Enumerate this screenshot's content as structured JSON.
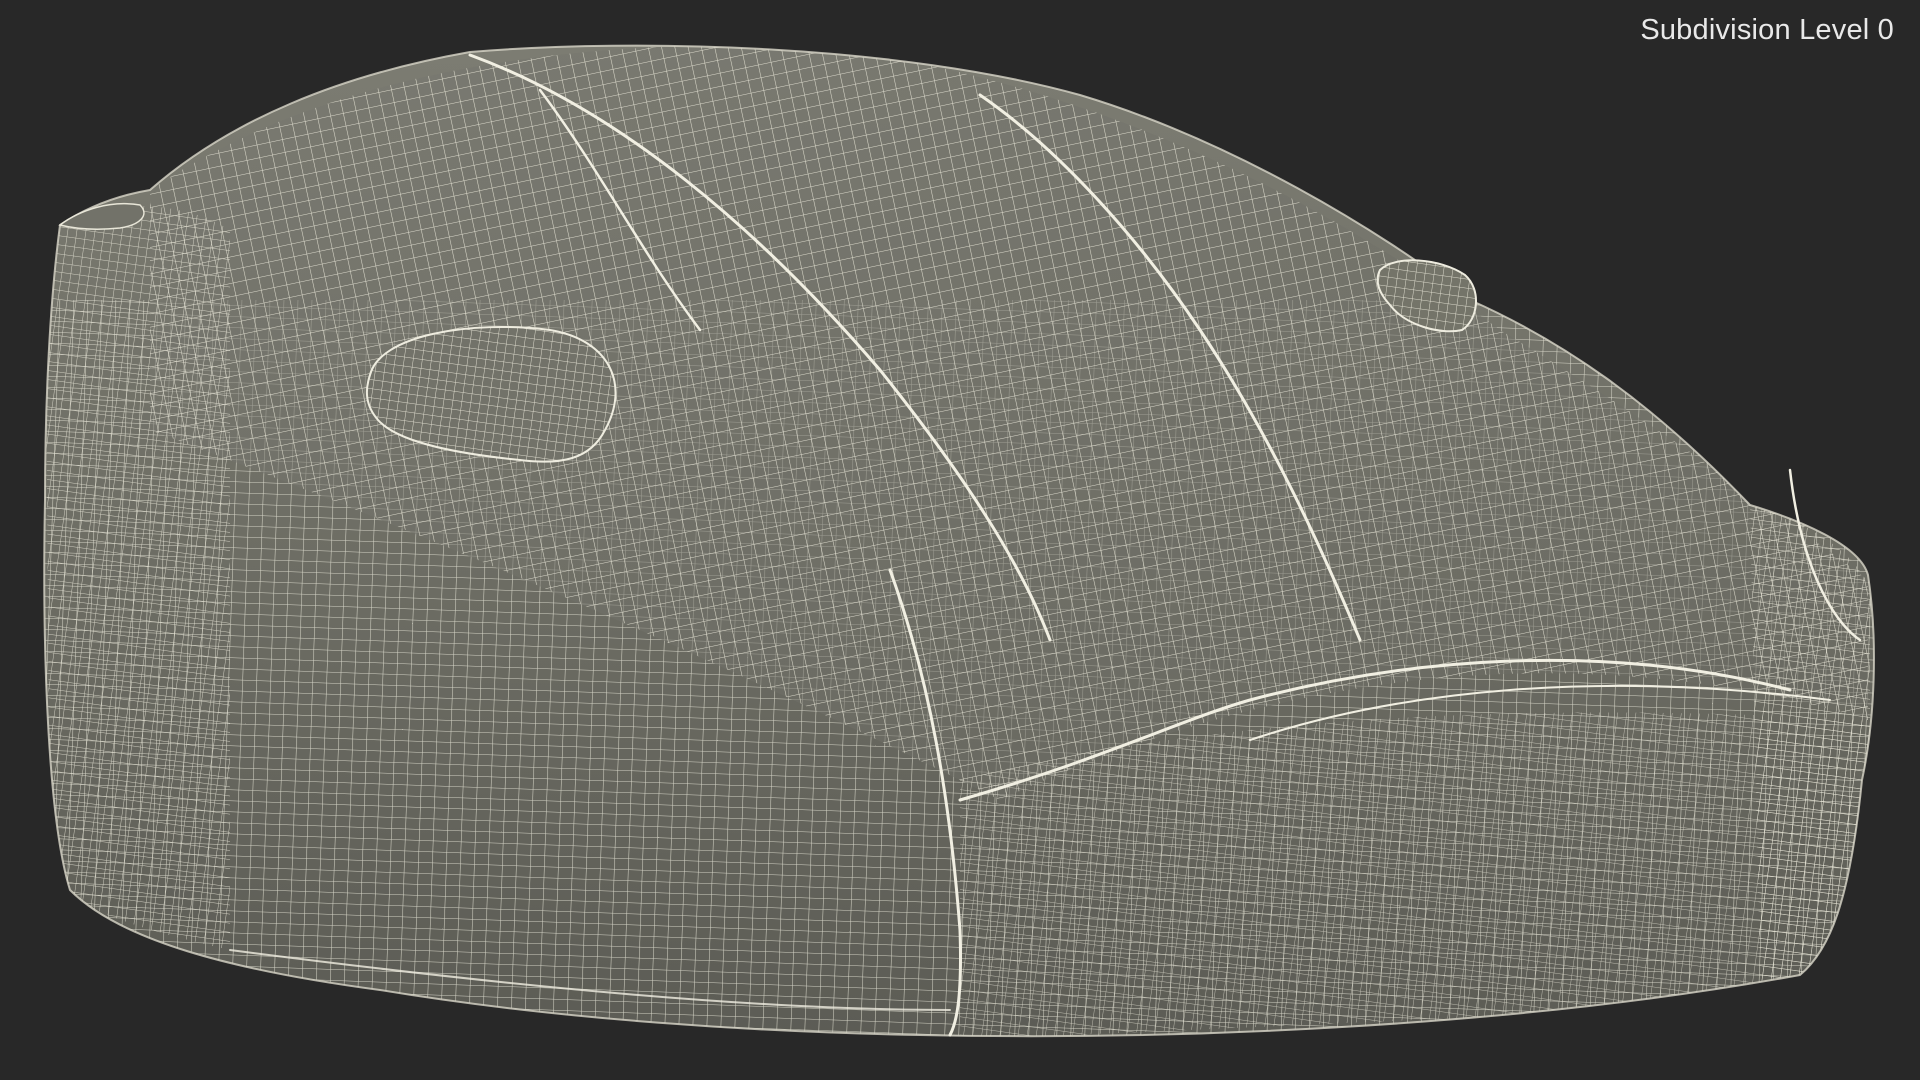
{
  "overlay": {
    "subdivision_label": "Subdivision Level 0"
  },
  "colors": {
    "background": "#282828",
    "mesh_fill": "#6f6f66",
    "mesh_fill_light": "#7a7a70",
    "mesh_fill_dark": "#55554e",
    "wire": "#e8e6d8",
    "seam": "#f1efe2"
  },
  "subject": {
    "icon": "car-cover-wireframe"
  }
}
